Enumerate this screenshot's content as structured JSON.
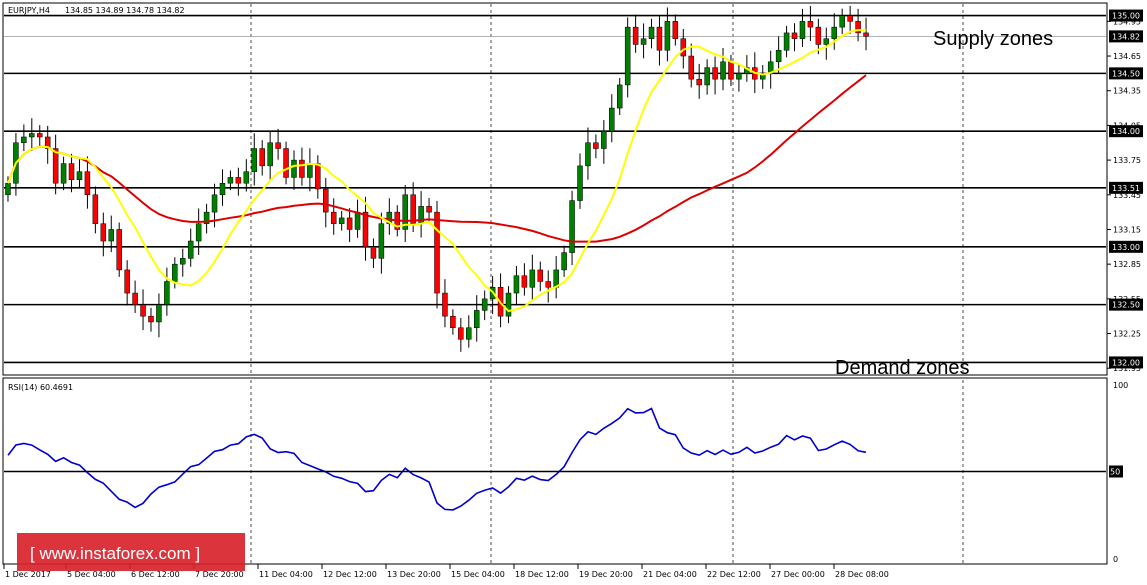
{
  "header": {
    "symbol": "EURJPY,H4",
    "ohlc": "134.85 134.89 134.78 134.82"
  },
  "annotations": {
    "supply": "Supply zones",
    "demand": "Demand zones"
  },
  "rsi": {
    "label": "RSI(14) 60.4691",
    "axis_labels": [
      "100",
      "50",
      "0"
    ]
  },
  "watermark": "[ www.instaforex.com ]",
  "colors": {
    "bull": "#008000",
    "bear": "#ff0000",
    "ma_fast": "#ffff00",
    "ma_slow": "#dd0000",
    "rsi": "#0000cc",
    "watermark_bg": "#d71e28"
  },
  "chart_data": [
    {
      "type": "candlestick",
      "title": "EURJPY,H4",
      "ylim": [
        131.9,
        135.1
      ],
      "y_ticks": [
        "134.95",
        "134.65",
        "134.35",
        "134.05",
        "133.75",
        "133.45",
        "133.15",
        "132.85",
        "132.55",
        "132.25",
        "131.95"
      ],
      "levels": [
        "135.00",
        "134.50",
        "134.00",
        "133.51",
        "133.00",
        "132.50",
        "132.00"
      ],
      "current_price": "134.82",
      "x_labels": [
        "1 Dec 2017",
        "5 Dec 04:00",
        "6 Dec 12:00",
        "7 Dec 20:00",
        "11 Dec 04:00",
        "12 Dec 12:00",
        "13 Dec 20:00",
        "15 Dec 04:00",
        "18 Dec 12:00",
        "19 Dec 20:00",
        "21 Dec 04:00",
        "22 Dec 12:00",
        "27 Dec 00:00",
        "28 Dec 08:00"
      ],
      "close": [
        133.55,
        133.9,
        133.95,
        133.98,
        133.95,
        133.85,
        133.55,
        133.72,
        133.58,
        133.65,
        133.45,
        133.2,
        133.05,
        133.15,
        132.8,
        132.6,
        132.5,
        132.4,
        132.35,
        132.5,
        132.7,
        132.85,
        132.9,
        133.05,
        133.2,
        133.3,
        133.45,
        133.55,
        133.6,
        133.55,
        133.65,
        133.85,
        133.7,
        133.9,
        133.85,
        133.6,
        133.75,
        133.6,
        133.72,
        133.5,
        133.3,
        133.2,
        133.25,
        133.15,
        133.3,
        133.0,
        132.9,
        133.2,
        133.3,
        133.15,
        133.45,
        133.2,
        133.35,
        133.3,
        132.6,
        132.4,
        132.3,
        132.2,
        132.3,
        132.45,
        132.55,
        132.65,
        132.4,
        132.6,
        132.75,
        132.65,
        132.8,
        132.7,
        132.65,
        132.8,
        132.95,
        133.4,
        133.7,
        133.9,
        133.85,
        134.0,
        134.2,
        134.4,
        134.9,
        134.75,
        134.8,
        134.9,
        134.7,
        134.95,
        134.8,
        134.65,
        134.45,
        134.4,
        134.55,
        134.45,
        134.6,
        134.45,
        134.5,
        134.55,
        134.45,
        134.5,
        134.6,
        134.7,
        134.85,
        134.8,
        134.95,
        134.9,
        134.75,
        134.8,
        134.9,
        135.0,
        134.95,
        134.85,
        134.82
      ],
      "series": [
        {
          "name": "",
          "color": "#ffff00"
        },
        {
          "name": "",
          "color": "#dd0000"
        }
      ]
    },
    {
      "type": "line",
      "title": "RSI(14) 60.4691",
      "ylim": [
        0,
        100
      ],
      "levels": [
        50
      ],
      "series": [
        {
          "name": "RSI(14)",
          "values": [
            58.9,
            64.5,
            65.3,
            64.4,
            61.8,
            59.4,
            55.5,
            57.5,
            54.9,
            53.5,
            49.4,
            45.7,
            43.6,
            39.2,
            34.8,
            33.3,
            30.4,
            32.6,
            37.7,
            41.4,
            42.8,
            44.3,
            48.6,
            52.7,
            53.7,
            57.3,
            61.0,
            61.9,
            64.4,
            65.2,
            68.9,
            70.3,
            68.3,
            62.4,
            60.4,
            60.8,
            59.9,
            54.9,
            53.2,
            51.4,
            49.8,
            47.4,
            46.3,
            44.5,
            43.5,
            39.0,
            39.5,
            45.2,
            48.4,
            46.6,
            51.8,
            48.3,
            46.5,
            44.2,
            32.8,
            29.3,
            29.0,
            31.1,
            34.3,
            38.1,
            39.8,
            41.0,
            38.2,
            41.6,
            46.3,
            45.3,
            47.5,
            45.6,
            45.1,
            48.4,
            52.6,
            60.4,
            67.4,
            71.7,
            70.3,
            73.6,
            76.3,
            79.3,
            84.3,
            82.0,
            82.2,
            84.4,
            73.7,
            71.2,
            70.1,
            62.8,
            60.1,
            58.9,
            61.4,
            59.3,
            61.7,
            59.4,
            60.5,
            63.2,
            60.1,
            61.2,
            63.3,
            64.9,
            69.6,
            67.3,
            69.4,
            68.2,
            61.5,
            62.3,
            64.6,
            66.6,
            64.8,
            61.3,
            60.5
          ]
        }
      ]
    }
  ]
}
